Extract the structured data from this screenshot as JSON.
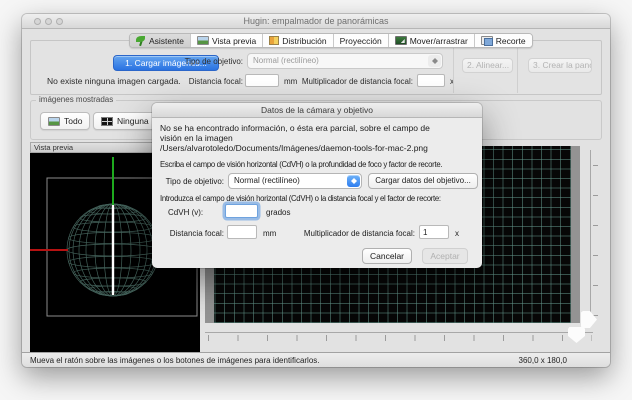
{
  "window_title": "Hugin: empalmador de panorámicas",
  "tabs": [
    {
      "label": "Asistente",
      "icon": "sprout-icon"
    },
    {
      "label": "Vista previa",
      "icon": "photo-icon"
    },
    {
      "label": "Distribución",
      "icon": "layout-icon"
    },
    {
      "label": "Proyección",
      "icon": ""
    },
    {
      "label": "Mover/arrastrar",
      "icon": "move-icon"
    },
    {
      "label": "Recorte",
      "icon": "crop-icon"
    }
  ],
  "toolbar": {
    "load_images_button": "1. Cargar imágenes...",
    "no_image_text": "No existe ninguna imagen cargada.",
    "lens_type_label": "Tipo de objetivo:",
    "lens_type_value": "Normal (rectilíneo)",
    "focal_length_label": "Distancia focal:",
    "focal_length_unit": "mm",
    "crop_factor_label": "Multiplicador de distancia focal:",
    "crop_factor_unit": "x",
    "align_button": "2. Alinear...",
    "create_button": "3. Crear la panor"
  },
  "displayed_images": {
    "group_label": "imágenes mostradas",
    "all_button": "Todo",
    "none_button": "Ninguna"
  },
  "preview": {
    "header": "Vista previa"
  },
  "dialog": {
    "title": "Datos de la cámara y objetivo",
    "message_line1": "No se ha encontrado información, o ésta era parcial, sobre el campo de",
    "message_line2": "visión en la imagen",
    "message_line3": "/Users/alvarotoledo/Documents/Imágenes/daemon-tools-for-mac-2.png",
    "instruction1": "Escriba el campo de visión horizontal (CdVH) o la profundidad de foco y factor de recorte.",
    "lens_type_label": "Tipo de objetivo:",
    "lens_type_value": "Normal (rectilíneo)",
    "load_lens_button": "Cargar datos del objetivo...",
    "instruction2": "Introduzca el campo de visión horizontal (CdVH) o la distancia focal y el factor de recorte:",
    "hfov_label": "CdVH (v):",
    "hfov_value": "",
    "hfov_unit": "grados",
    "focal_length_label": "Distancia focal:",
    "focal_length_value": "",
    "focal_length_unit": "mm",
    "crop_factor_label": "Multiplicador de distancia focal:",
    "crop_factor_value": "1",
    "crop_factor_unit": "x",
    "cancel_button": "Cancelar",
    "accept_button": "Aceptar"
  },
  "statusbar": {
    "message": "Mueva el ratón sobre las imágenes o los botones de imágenes para identificarlos.",
    "pano_size": "360,0 x 180,0"
  },
  "colors": {
    "accent_blue": "#3b82f0",
    "grid_teal": "#609287",
    "axis_green": "#1faa1f",
    "axis_red": "#b51212"
  }
}
